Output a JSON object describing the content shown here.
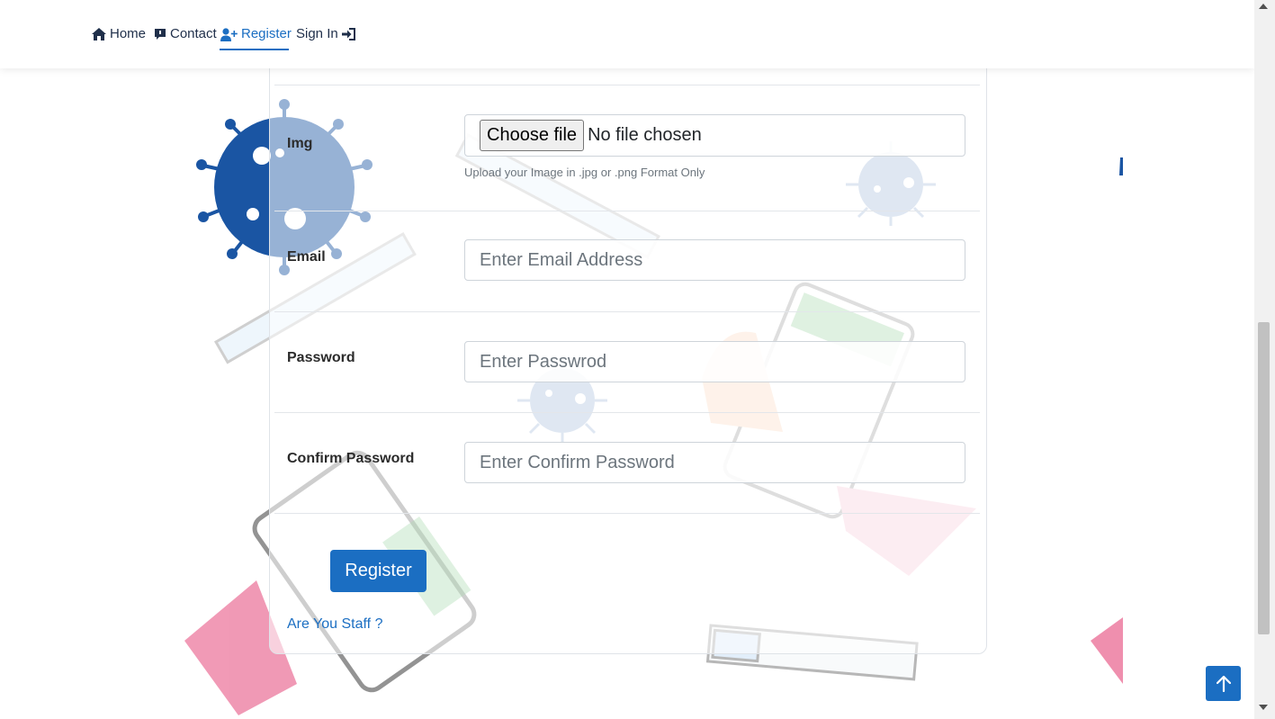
{
  "nav": {
    "items": [
      {
        "label": "Home",
        "icon": "home-icon"
      },
      {
        "label": "Contact",
        "icon": "message-icon"
      },
      {
        "label": "Register",
        "icon": "user-plus-icon",
        "active": true
      },
      {
        "label": "Sign In",
        "icon": "sign-in-icon"
      }
    ]
  },
  "form": {
    "img": {
      "label": "Img",
      "button_label": "Choose file",
      "status": "No file chosen",
      "help": "Upload your Image in .jpg or .png Format Only"
    },
    "email": {
      "label": "Email",
      "placeholder": "Enter Email Address"
    },
    "password": {
      "label": "Password",
      "placeholder": "Enter Passwrod"
    },
    "confirm": {
      "label": "Confirm Password",
      "placeholder": "Enter Confirm Password"
    },
    "submit_label": "Register",
    "staff_link": "Are You Staff ?"
  },
  "colors": {
    "accent": "#1b6ec2",
    "virus_dark": "#1a55a3",
    "virus_light": "#d7e0ef"
  }
}
